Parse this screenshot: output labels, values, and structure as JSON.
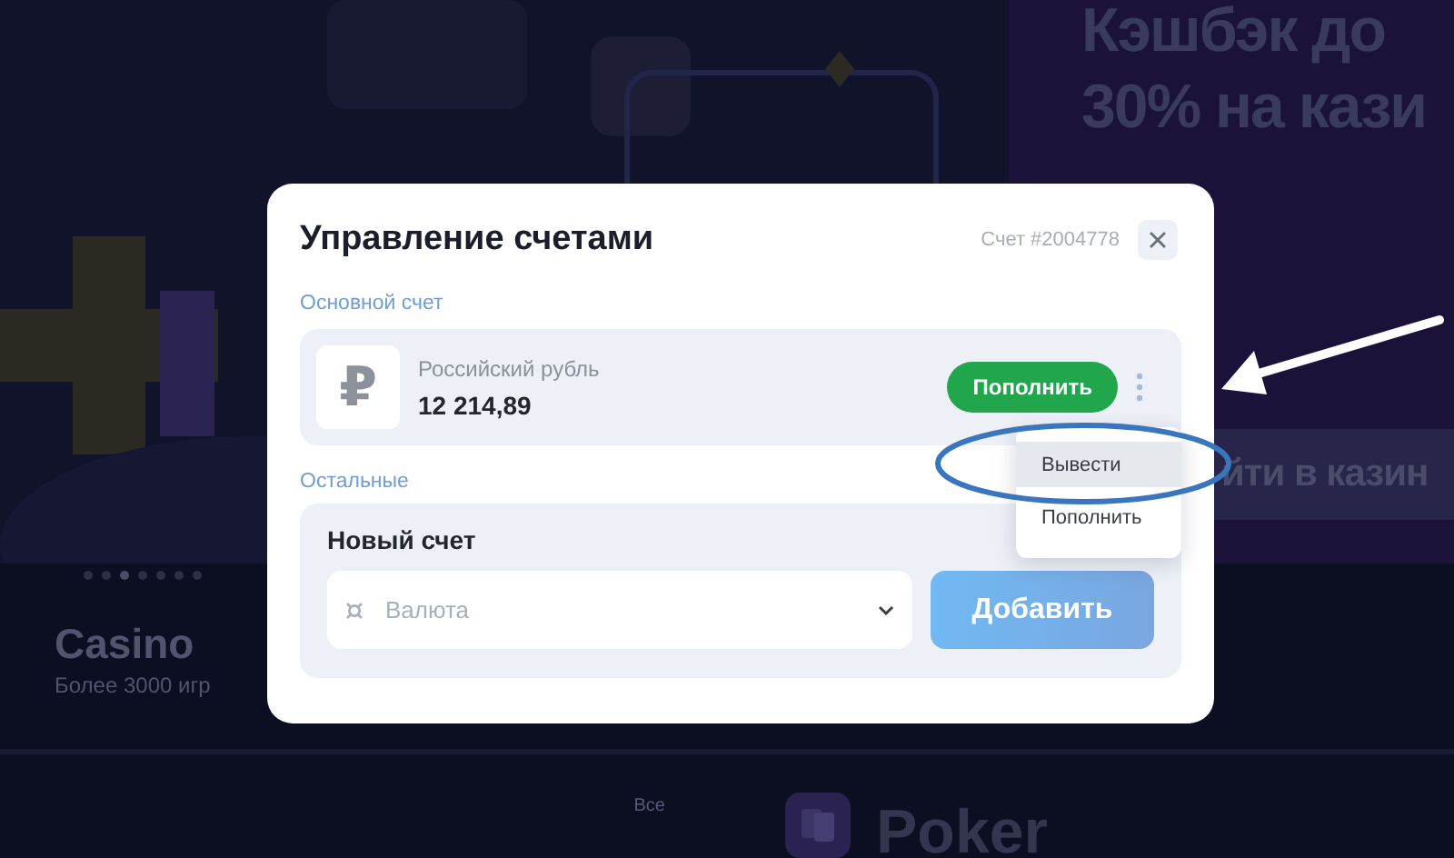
{
  "background": {
    "promo_banner": {
      "title_lines": [
        "Кэшбэк до",
        "30% на кази"
      ],
      "button": "йти в казин"
    },
    "carousel": {
      "dots": [
        {
          "selected": false
        },
        {
          "selected": false
        },
        {
          "selected": true
        },
        {
          "selected": false
        },
        {
          "selected": false
        },
        {
          "selected": false
        },
        {
          "selected": false
        }
      ]
    },
    "casino_card": {
      "title": "Casino",
      "subtitle": "Более 3000 игр"
    },
    "all_link": "Все",
    "poker_card": {
      "title": "Poker"
    }
  },
  "dialog": {
    "title": "Управление счетами",
    "account_number": "Счет #2004778",
    "main_section": {
      "label": "Основной счет",
      "account": {
        "currency_symbol": "₽",
        "currency": "Российский рубль",
        "balance": "12 214,89",
        "deposit_button": "Пополнить",
        "menu": [
          {
            "label": "Вывести",
            "selected": true
          },
          {
            "label": "Пополнить",
            "selected": false
          }
        ]
      }
    },
    "other_section": {
      "label": "Остальные",
      "new_account": {
        "title": "Новый счет",
        "currency_select": {
          "placeholder": "Валюта"
        },
        "add_button": "Добавить"
      }
    }
  }
}
